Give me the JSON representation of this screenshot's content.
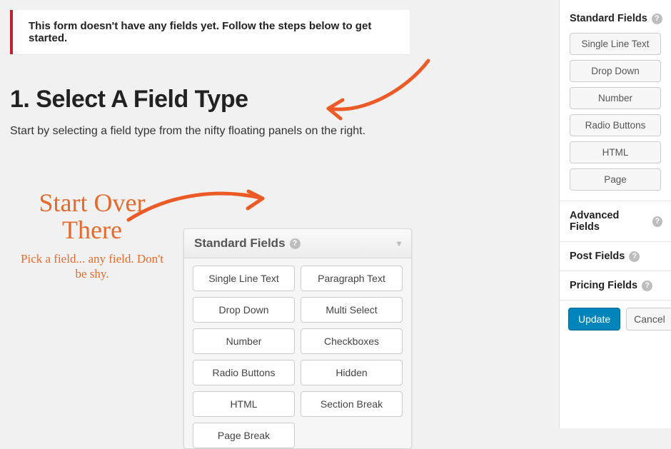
{
  "notice": "This form doesn't have any fields yet. Follow the steps below to get started.",
  "heading": "1. Select A Field Type",
  "description": "Start by selecting a field type from the nifty floating panels on the right.",
  "hand": {
    "line1": "Start Over",
    "line2": "There",
    "sub": "Pick a field... any field. Don't be shy."
  },
  "help_glyph": "?",
  "illus_panel": {
    "title": "Standard Fields",
    "caret": "▾",
    "fields": [
      "Single Line Text",
      "Paragraph Text",
      "Drop Down",
      "Multi Select",
      "Number",
      "Checkboxes",
      "Radio Buttons",
      "Hidden",
      "HTML",
      "Section Break",
      "Page Break"
    ]
  },
  "sidebar": {
    "sections": [
      {
        "title": "Standard Fields",
        "fields": [
          "Single Line Text",
          "Drop Down",
          "Number",
          "Radio Buttons",
          "HTML",
          "Page"
        ]
      },
      {
        "title": "Advanced Fields",
        "fields": []
      },
      {
        "title": "Post Fields",
        "fields": []
      },
      {
        "title": "Pricing Fields",
        "fields": []
      }
    ],
    "update": "Update",
    "cancel": "Cancel"
  }
}
